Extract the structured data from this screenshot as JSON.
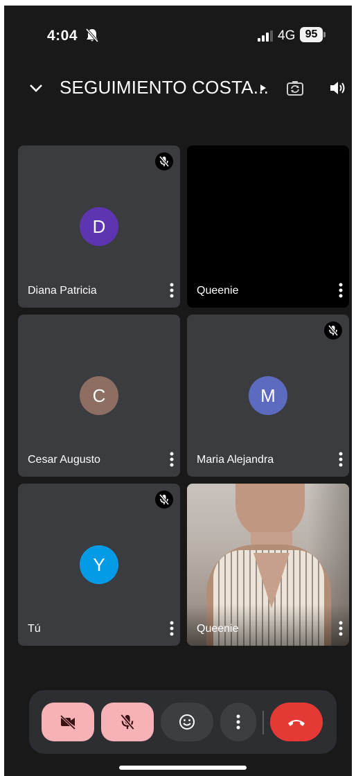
{
  "status_bar": {
    "time": "4:04",
    "network": "4G",
    "battery": "95"
  },
  "header": {
    "title": "SEGUIMIENTO COSTA..."
  },
  "participants": [
    {
      "name": "Diana Patricia",
      "initial": "D",
      "avatar_color": "#5e35b1",
      "muted": true
    },
    {
      "name": "Queenie",
      "initial": "",
      "muted": false,
      "video": "black"
    },
    {
      "name": "Cesar Augusto",
      "initial": "C",
      "avatar_color": "#8d6e63",
      "muted": false
    },
    {
      "name": "Maria Alejandra",
      "initial": "M",
      "avatar_color": "#5c6bc0",
      "muted": true
    },
    {
      "name": "Tú",
      "initial": "Y",
      "avatar_color": "#039be5",
      "muted": true
    },
    {
      "name": "Queenie",
      "initial": "",
      "muted": false,
      "video": "camera"
    }
  ],
  "controls": {
    "camera_icon": "videocam-off-icon",
    "mic_icon": "mic-off-icon",
    "emoji_icon": "emoji-icon",
    "more_icon": "more-vert-icon",
    "end_call_icon": "call-end-icon"
  },
  "colors": {
    "background": "#191919",
    "tile": "#3b3c3f",
    "control_bar": "#2d2e31",
    "muted_button": "#f6b2b6",
    "end_call": "#e53935"
  }
}
